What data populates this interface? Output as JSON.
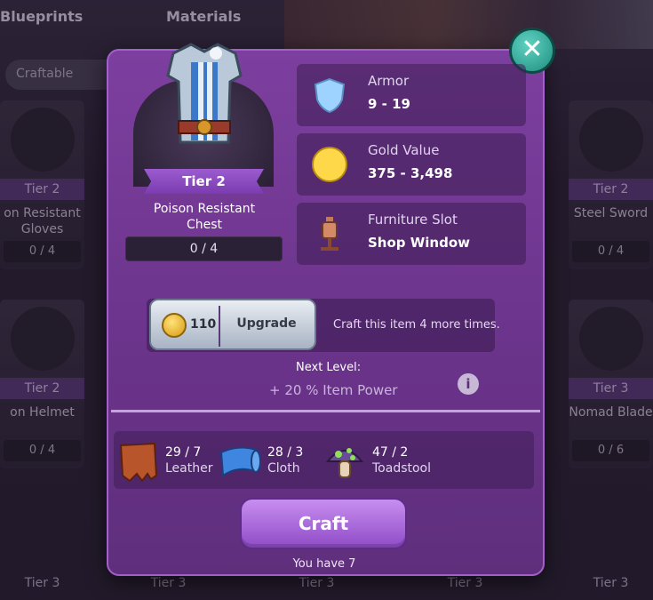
{
  "tabs": {
    "blueprints": "Blueprints",
    "materials": "Materials"
  },
  "filter": {
    "label": "Craftable"
  },
  "bg_cards": [
    {
      "tier": "Tier 2",
      "name": "on Resistant\nGloves",
      "count": "0 / 4"
    },
    {
      "tier": "Tier 2",
      "name": "on Helmet",
      "count": "0 / 4"
    },
    {
      "tier": "Tier 2",
      "name": "Steel Sword",
      "count": "0 / 4"
    },
    {
      "tier": "Tier 3",
      "name": "Nomad Blade",
      "count": "0 / 6"
    }
  ],
  "bottom_tiers": [
    "Tier 3",
    "Tier 3",
    "Tier 3",
    "Tier 3",
    "Tier 3"
  ],
  "item": {
    "tier": "Tier 2",
    "name": "Poison Resistant\nChest",
    "count": "0 / 4"
  },
  "stats": {
    "armor": {
      "label": "Armor",
      "value": "9 - 19",
      "icon": "shield-icon"
    },
    "gold": {
      "label": "Gold Value",
      "value": "375 - 3,498",
      "icon": "gold-coin-icon"
    },
    "furniture": {
      "label": "Furniture Slot",
      "value": "Shop Window",
      "icon": "mannequin-icon"
    }
  },
  "upgrade": {
    "cost": "110",
    "label": "Upgrade",
    "craft_more": "Craft this item 4 more times."
  },
  "next_level": {
    "label": "Next Level:",
    "value": "+ 20 % Item Power"
  },
  "materials": [
    {
      "count": "29 / 7",
      "name": "Leather",
      "icon": "leather-icon"
    },
    {
      "count": "28 / 3",
      "name": "Cloth",
      "icon": "cloth-icon"
    },
    {
      "count": "47 / 2",
      "name": "Toadstool",
      "icon": "toadstool-icon"
    }
  ],
  "craft": {
    "label": "Craft",
    "you_have": "You have 7"
  },
  "colors": {
    "modal": "#7d3f9f",
    "accent": "#9c5cd0",
    "close": "#2fae9e"
  }
}
